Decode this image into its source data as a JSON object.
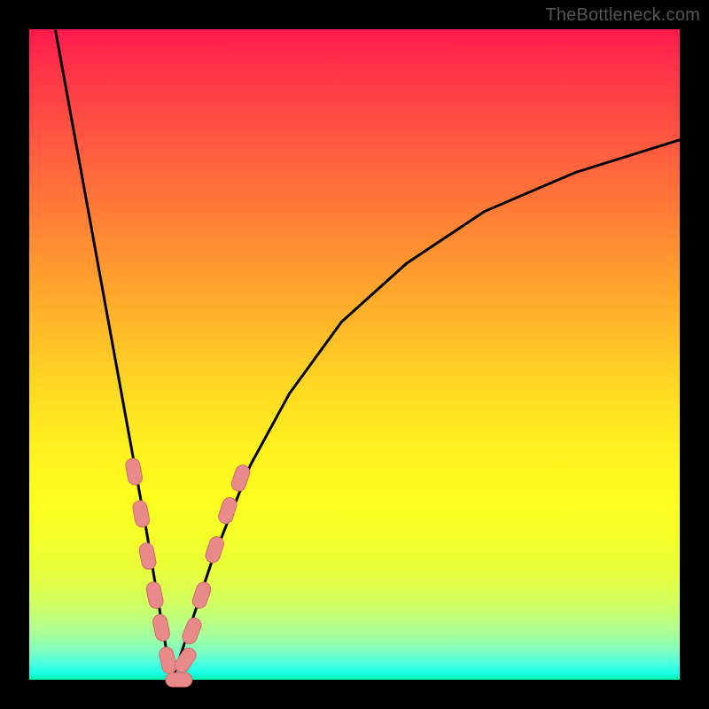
{
  "watermark": "TheBottleneck.com",
  "colors": {
    "frame": "#000000",
    "curve": "#000000",
    "marker_fill": "#e88a8a",
    "marker_stroke": "#d46a6a"
  },
  "chart_data": {
    "type": "line",
    "title": "",
    "xlabel": "",
    "ylabel": "",
    "xlim": [
      0,
      100
    ],
    "ylim": [
      0,
      100
    ],
    "grid": false,
    "note": "Axes are unlabeled in the source image; percentages are positional estimates. The two black curves form a V shape with its vertex near x≈22, y≈0. Pink rounded markers cluster on both arms near the vertex.",
    "series": [
      {
        "name": "left-arm",
        "x": [
          4,
          6,
          8,
          10,
          12,
          14,
          16,
          18,
          19,
          20,
          21,
          22
        ],
        "y": [
          100,
          89,
          78,
          67,
          56,
          45,
          34,
          23,
          17,
          11,
          5,
          0
        ]
      },
      {
        "name": "right-arm",
        "x": [
          22,
          24,
          26,
          28,
          30,
          34,
          40,
          48,
          58,
          70,
          84,
          100
        ],
        "y": [
          0,
          6,
          12,
          18,
          23,
          33,
          44,
          55,
          64,
          72,
          78,
          83
        ]
      }
    ],
    "markers": [
      {
        "arm": "left",
        "x": 16.1,
        "y": 32.0
      },
      {
        "arm": "left",
        "x": 17.2,
        "y": 25.5
      },
      {
        "arm": "left",
        "x": 18.2,
        "y": 19.0
      },
      {
        "arm": "left",
        "x": 19.3,
        "y": 13.0
      },
      {
        "arm": "left",
        "x": 20.3,
        "y": 8.0
      },
      {
        "arm": "left",
        "x": 21.3,
        "y": 3.0
      },
      {
        "arm": "right",
        "x": 23.0,
        "y": 0.0
      },
      {
        "arm": "right",
        "x": 24.0,
        "y": 3.0
      },
      {
        "arm": "right",
        "x": 25.0,
        "y": 7.5
      },
      {
        "arm": "right",
        "x": 26.5,
        "y": 13.0
      },
      {
        "arm": "right",
        "x": 28.5,
        "y": 20.0
      },
      {
        "arm": "right",
        "x": 30.5,
        "y": 26.0
      },
      {
        "arm": "right",
        "x": 32.5,
        "y": 31.0
      }
    ]
  }
}
